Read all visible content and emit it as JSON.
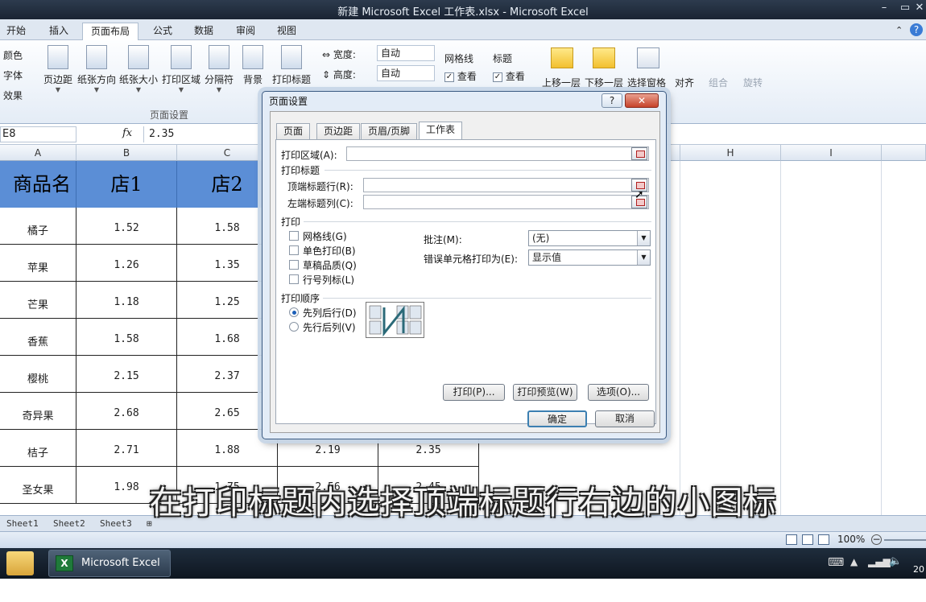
{
  "window": {
    "title": "新建 Microsoft Excel 工作表.xlsx  -  Microsoft Excel"
  },
  "ribbon_tabs": [
    "开始",
    "插入",
    "页面布局",
    "公式",
    "数据",
    "审阅",
    "视图"
  ],
  "ribbon": {
    "left_items": [
      "颜色",
      "字体",
      "效果"
    ],
    "buttons": [
      "页边距",
      "纸张方向",
      "纸张大小",
      "打印区域",
      "分隔符",
      "背景",
      "打印标题"
    ],
    "group_page_setup": "页面设置",
    "width_label": "宽度:",
    "width_value": "自动",
    "height_label": "高度:",
    "height_value": "自动",
    "gridlines_label": "网格线",
    "headings_label": "标题",
    "view_label": "查看",
    "arrange_buttons": [
      "上移一层",
      "下移一层",
      "选择窗格",
      "对齐",
      "组合",
      "旋转"
    ]
  },
  "formula_bar": {
    "name_box": "E8",
    "fx": "fx",
    "value": "2.35"
  },
  "sheet": {
    "columns": [
      "A",
      "B",
      "C",
      "H",
      "I"
    ],
    "header_row": [
      "商品名称",
      "店1",
      "店2"
    ],
    "rows": [
      {
        "name": "橘子",
        "b": "1.52",
        "c": "1.58"
      },
      {
        "name": "苹果",
        "b": "1.26",
        "c": "1.35"
      },
      {
        "name": "芒果",
        "b": "1.18",
        "c": "1.25"
      },
      {
        "name": "香蕉",
        "b": "1.58",
        "c": "1.68"
      },
      {
        "name": "樱桃",
        "b": "2.15",
        "c": "2.37"
      },
      {
        "name": "奇异果",
        "b": "2.68",
        "c": "2.65"
      },
      {
        "name": "桔子",
        "b": "2.71",
        "c": "1.88",
        "d": "2.19",
        "e": "2.35"
      },
      {
        "name": "圣女果",
        "b": "1.98",
        "c": "1.75",
        "d": "2.56",
        "e": "2.45"
      }
    ],
    "tabs": [
      "Sheet1",
      "Sheet2",
      "Sheet3"
    ]
  },
  "status": {
    "zoom": "100%"
  },
  "taskbar": {
    "excel_item": "Microsoft Excel ...",
    "clock_partial": "20"
  },
  "dialog": {
    "title": "页面设置",
    "help": "?",
    "close": "✕",
    "tabs": [
      "页面",
      "页边距",
      "页眉/页脚",
      "工作表"
    ],
    "active_tab": 3,
    "print_area_label": "打印区域(A):",
    "print_titles_label": "打印标题",
    "top_rows_label": "顶端标题行(R):",
    "left_cols_label": "左端标题列(C):",
    "print_section": "打印",
    "checkboxes": [
      "网格线(G)",
      "单色打印(B)",
      "草稿品质(Q)",
      "行号列标(L)"
    ],
    "comments_label": "批注(M):",
    "comments_value": "(无)",
    "errors_label": "错误单元格打印为(E):",
    "errors_value": "显示值",
    "order_section": "打印顺序",
    "order_options": [
      "先列后行(D)",
      "先行后列(V)"
    ],
    "order_selected": 0,
    "print_btn": "打印(P)...",
    "preview_btn": "打印预览(W)",
    "options_btn": "选项(O)...",
    "ok_btn": "确定",
    "cancel_btn": "取消"
  },
  "subtitle": "在打印标题内选择顶端标题行右边的小图标"
}
